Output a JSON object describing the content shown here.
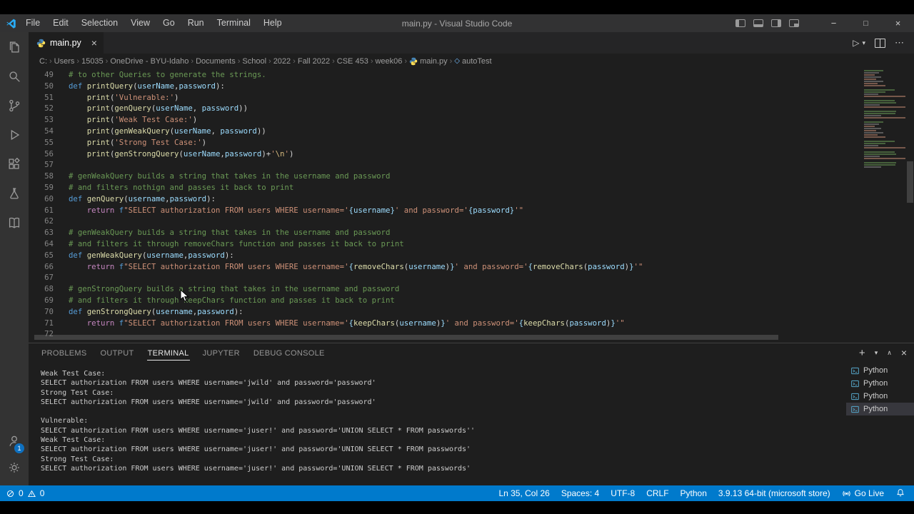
{
  "title_bar": {
    "menus": [
      "File",
      "Edit",
      "Selection",
      "View",
      "Go",
      "Run",
      "Terminal",
      "Help"
    ],
    "title": "main.py - Visual Studio Code"
  },
  "glyphs": {
    "close": "×",
    "minimize": "−",
    "maximize": "□",
    "plus": "+",
    "chevron_down": "▾",
    "chevron_up": "∧",
    "ellipsis": "⋯",
    "run": "▷",
    "crumb_sep": "›",
    "symbol": "◇"
  },
  "activity_bar": {
    "items": [
      {
        "name": "explorer",
        "icon": "files-icon"
      },
      {
        "name": "search",
        "icon": "search-icon"
      },
      {
        "name": "source-control",
        "icon": "source-control-icon"
      },
      {
        "name": "run-debug",
        "icon": "run-debug-icon"
      },
      {
        "name": "extensions",
        "icon": "extensions-icon"
      },
      {
        "name": "testing",
        "icon": "beaker-icon"
      },
      {
        "name": "notebooks",
        "icon": "book-icon"
      }
    ],
    "account_badge": "1"
  },
  "tab_bar": {
    "tabs": [
      {
        "label": "main.py",
        "active": true,
        "icon": "python-file-icon"
      }
    ]
  },
  "breadcrumbs": {
    "items": [
      {
        "label": "C:"
      },
      {
        "label": "Users"
      },
      {
        "label": "15035"
      },
      {
        "label": "OneDrive - BYU-Idaho"
      },
      {
        "label": "Documents"
      },
      {
        "label": "School"
      },
      {
        "label": "2022"
      },
      {
        "label": "Fall 2022"
      },
      {
        "label": "CSE 453"
      },
      {
        "label": "week06"
      },
      {
        "label": "main.py",
        "icon": "python"
      },
      {
        "label": "autoTest",
        "icon": "symbol"
      }
    ]
  },
  "editor": {
    "lines": [
      {
        "num": "49",
        "tokens": [
          {
            "t": "# to other Queries to generate the strings.",
            "c": "comment"
          }
        ]
      },
      {
        "num": "50",
        "tokens": [
          {
            "t": "def",
            "c": "kw"
          },
          {
            "t": " ",
            "c": "plain"
          },
          {
            "t": "printQuery",
            "c": "fn"
          },
          {
            "t": "(",
            "c": "plain"
          },
          {
            "t": "userName",
            "c": "var"
          },
          {
            "t": ",",
            "c": "plain"
          },
          {
            "t": "password",
            "c": "var"
          },
          {
            "t": "):",
            "c": "plain"
          }
        ]
      },
      {
        "num": "51",
        "tokens": [
          {
            "t": "    ",
            "c": "plain"
          },
          {
            "t": "print",
            "c": "fn"
          },
          {
            "t": "(",
            "c": "plain"
          },
          {
            "t": "'Vulnerable:'",
            "c": "str"
          },
          {
            "t": ")",
            "c": "plain"
          }
        ]
      },
      {
        "num": "52",
        "tokens": [
          {
            "t": "    ",
            "c": "plain"
          },
          {
            "t": "print",
            "c": "fn"
          },
          {
            "t": "(",
            "c": "plain"
          },
          {
            "t": "genQuery",
            "c": "fn"
          },
          {
            "t": "(",
            "c": "plain"
          },
          {
            "t": "userName",
            "c": "var"
          },
          {
            "t": ", ",
            "c": "plain"
          },
          {
            "t": "password",
            "c": "var"
          },
          {
            "t": "))",
            "c": "plain"
          }
        ]
      },
      {
        "num": "53",
        "tokens": [
          {
            "t": "    ",
            "c": "plain"
          },
          {
            "t": "print",
            "c": "fn"
          },
          {
            "t": "(",
            "c": "plain"
          },
          {
            "t": "'Weak Test Case:'",
            "c": "str"
          },
          {
            "t": ")",
            "c": "plain"
          }
        ]
      },
      {
        "num": "54",
        "tokens": [
          {
            "t": "    ",
            "c": "plain"
          },
          {
            "t": "print",
            "c": "fn"
          },
          {
            "t": "(",
            "c": "plain"
          },
          {
            "t": "genWeakQuery",
            "c": "fn"
          },
          {
            "t": "(",
            "c": "plain"
          },
          {
            "t": "userName",
            "c": "var"
          },
          {
            "t": ", ",
            "c": "plain"
          },
          {
            "t": "password",
            "c": "var"
          },
          {
            "t": "))",
            "c": "plain"
          }
        ]
      },
      {
        "num": "55",
        "tokens": [
          {
            "t": "    ",
            "c": "plain"
          },
          {
            "t": "print",
            "c": "fn"
          },
          {
            "t": "(",
            "c": "plain"
          },
          {
            "t": "'Strong Test Case:'",
            "c": "str"
          },
          {
            "t": ")",
            "c": "plain"
          }
        ]
      },
      {
        "num": "56",
        "tokens": [
          {
            "t": "    ",
            "c": "plain"
          },
          {
            "t": "print",
            "c": "fn"
          },
          {
            "t": "(",
            "c": "plain"
          },
          {
            "t": "genStrongQuery",
            "c": "fn"
          },
          {
            "t": "(",
            "c": "plain"
          },
          {
            "t": "userName",
            "c": "var"
          },
          {
            "t": ",",
            "c": "plain"
          },
          {
            "t": "password",
            "c": "var"
          },
          {
            "t": ")+",
            "c": "plain"
          },
          {
            "t": "'",
            "c": "str"
          },
          {
            "t": "\\n",
            "c": "esc"
          },
          {
            "t": "'",
            "c": "str"
          },
          {
            "t": ")",
            "c": "plain"
          }
        ]
      },
      {
        "num": "57",
        "tokens": []
      },
      {
        "num": "58",
        "tokens": [
          {
            "t": "# genWeakQuery builds a string that takes in the username and password",
            "c": "comment"
          }
        ]
      },
      {
        "num": "59",
        "tokens": [
          {
            "t": "# and filters nothign and passes it back to print",
            "c": "comment"
          }
        ]
      },
      {
        "num": "60",
        "tokens": [
          {
            "t": "def",
            "c": "kw"
          },
          {
            "t": " ",
            "c": "plain"
          },
          {
            "t": "genQuery",
            "c": "fn"
          },
          {
            "t": "(",
            "c": "plain"
          },
          {
            "t": "username",
            "c": "var"
          },
          {
            "t": ",",
            "c": "plain"
          },
          {
            "t": "password",
            "c": "var"
          },
          {
            "t": "):",
            "c": "plain"
          }
        ]
      },
      {
        "num": "61",
        "tokens": [
          {
            "t": "    ",
            "c": "plain"
          },
          {
            "t": "return",
            "c": "ctrl"
          },
          {
            "t": " ",
            "c": "plain"
          },
          {
            "t": "f",
            "c": "kw"
          },
          {
            "t": "\"SELECT authorization FROM users WHERE username='",
            "c": "str"
          },
          {
            "t": "{username}",
            "c": "var"
          },
          {
            "t": "' and password='",
            "c": "str"
          },
          {
            "t": "{password}",
            "c": "var"
          },
          {
            "t": "'\"",
            "c": "str"
          }
        ]
      },
      {
        "num": "62",
        "tokens": []
      },
      {
        "num": "63",
        "tokens": [
          {
            "t": "# genWeakQuery builds a string that takes in the username and password",
            "c": "comment"
          }
        ]
      },
      {
        "num": "64",
        "tokens": [
          {
            "t": "# and filters it through removeChars function and passes it back to print",
            "c": "comment"
          }
        ]
      },
      {
        "num": "65",
        "tokens": [
          {
            "t": "def",
            "c": "kw"
          },
          {
            "t": " ",
            "c": "plain"
          },
          {
            "t": "genWeakQuery",
            "c": "fn"
          },
          {
            "t": "(",
            "c": "plain"
          },
          {
            "t": "username",
            "c": "var"
          },
          {
            "t": ",",
            "c": "plain"
          },
          {
            "t": "password",
            "c": "var"
          },
          {
            "t": "):",
            "c": "plain"
          }
        ]
      },
      {
        "num": "66",
        "tokens": [
          {
            "t": "    ",
            "c": "plain"
          },
          {
            "t": "return",
            "c": "ctrl"
          },
          {
            "t": " ",
            "c": "plain"
          },
          {
            "t": "f",
            "c": "kw"
          },
          {
            "t": "\"SELECT authorization FROM users WHERE username='",
            "c": "str"
          },
          {
            "t": "{",
            "c": "var"
          },
          {
            "t": "removeChars",
            "c": "fn"
          },
          {
            "t": "(",
            "c": "plain"
          },
          {
            "t": "username",
            "c": "var"
          },
          {
            "t": ")",
            "c": "plain"
          },
          {
            "t": "}",
            "c": "var"
          },
          {
            "t": "' and password='",
            "c": "str"
          },
          {
            "t": "{",
            "c": "var"
          },
          {
            "t": "removeChars",
            "c": "fn"
          },
          {
            "t": "(",
            "c": "plain"
          },
          {
            "t": "password",
            "c": "var"
          },
          {
            "t": ")",
            "c": "plain"
          },
          {
            "t": "}",
            "c": "var"
          },
          {
            "t": "'\"",
            "c": "str"
          }
        ]
      },
      {
        "num": "67",
        "tokens": []
      },
      {
        "num": "68",
        "tokens": [
          {
            "t": "# genStrongQuery builds a string that takes in the username and password",
            "c": "comment"
          }
        ]
      },
      {
        "num": "69",
        "tokens": [
          {
            "t": "# and filters it through keepChars function and passes it back to print",
            "c": "comment"
          }
        ]
      },
      {
        "num": "70",
        "tokens": [
          {
            "t": "def",
            "c": "kw"
          },
          {
            "t": " ",
            "c": "plain"
          },
          {
            "t": "genStrongQuery",
            "c": "fn"
          },
          {
            "t": "(",
            "c": "plain"
          },
          {
            "t": "username",
            "c": "var"
          },
          {
            "t": ",",
            "c": "plain"
          },
          {
            "t": "password",
            "c": "var"
          },
          {
            "t": "):",
            "c": "plain"
          }
        ]
      },
      {
        "num": "71",
        "tokens": [
          {
            "t": "    ",
            "c": "plain"
          },
          {
            "t": "return",
            "c": "ctrl"
          },
          {
            "t": " ",
            "c": "plain"
          },
          {
            "t": "f",
            "c": "kw"
          },
          {
            "t": "\"SELECT authorization FROM users WHERE username='",
            "c": "str"
          },
          {
            "t": "{",
            "c": "var"
          },
          {
            "t": "keepChars",
            "c": "fn"
          },
          {
            "t": "(",
            "c": "plain"
          },
          {
            "t": "username",
            "c": "var"
          },
          {
            "t": ")",
            "c": "plain"
          },
          {
            "t": "}",
            "c": "var"
          },
          {
            "t": "' and password='",
            "c": "str"
          },
          {
            "t": "{",
            "c": "var"
          },
          {
            "t": "keepChars",
            "c": "fn"
          },
          {
            "t": "(",
            "c": "plain"
          },
          {
            "t": "password",
            "c": "var"
          },
          {
            "t": ")",
            "c": "plain"
          },
          {
            "t": "}",
            "c": "var"
          },
          {
            "t": "'\"",
            "c": "str"
          }
        ]
      },
      {
        "num": "72",
        "tokens": []
      }
    ]
  },
  "panel": {
    "tabs": [
      {
        "label": "PROBLEMS"
      },
      {
        "label": "OUTPUT"
      },
      {
        "label": "TERMINAL",
        "active": true
      },
      {
        "label": "JUPYTER"
      },
      {
        "label": "DEBUG CONSOLE"
      }
    ],
    "terminal_lines": [
      "Weak Test Case:",
      "SELECT authorization FROM users WHERE username='jwild' and password='password'",
      "Strong Test Case:",
      "SELECT authorization FROM users WHERE username='jwild' and password='password'",
      "",
      "Vulnerable:",
      "SELECT authorization FROM users WHERE username='juser!' and password='UNION SELECT * FROM passwords''",
      "Weak Test Case:",
      "SELECT authorization FROM users WHERE username='juser!' and password='UNION SELECT * FROM passwords'",
      "Strong Test Case:",
      "SELECT authorization FROM users WHERE username='juser!' and password='UNION SELECT * FROM passwords'"
    ],
    "terminal_list": [
      {
        "label": "Python"
      },
      {
        "label": "Python"
      },
      {
        "label": "Python"
      },
      {
        "label": "Python",
        "active": true
      }
    ]
  },
  "status_bar": {
    "errors": "0",
    "warnings": "0",
    "items": [
      {
        "label": "Ln 35, Col 26",
        "name": "cursor-position"
      },
      {
        "label": "Spaces: 4",
        "name": "indentation"
      },
      {
        "label": "UTF-8",
        "name": "encoding"
      },
      {
        "label": "CRLF",
        "name": "eol"
      },
      {
        "label": "Python",
        "name": "language-mode"
      },
      {
        "label": "3.9.13 64-bit (microsoft store)",
        "name": "python-interpreter"
      },
      {
        "label": "Go Live",
        "name": "go-live",
        "icon": "broadcast"
      }
    ]
  },
  "colors": {
    "statusbar": "#007acc",
    "titlebar": "#323233",
    "activitybar": "#333333",
    "editor_bg": "#1e1e1e",
    "tabbar_bg": "#252526"
  }
}
